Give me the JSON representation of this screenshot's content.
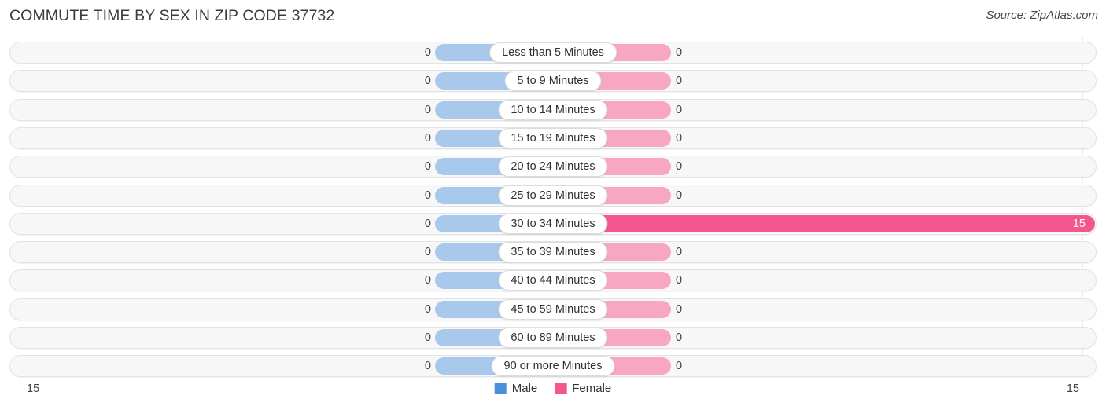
{
  "header": {
    "title": "COMMUTE TIME BY SEX IN ZIP CODE 37732",
    "source": "Source: ZipAtlas.com"
  },
  "legend": {
    "male_label": "Male",
    "female_label": "Female",
    "male_color": "#4a90d9",
    "female_color": "#f4568f"
  },
  "axis": {
    "left": "15",
    "right": "15"
  },
  "chart_data": {
    "type": "bar",
    "title": "COMMUTE TIME BY SEX IN ZIP CODE 37732",
    "orientation": "horizontal-diverging",
    "xlabel": "",
    "ylabel": "",
    "xlim": [
      15,
      15
    ],
    "grid": true,
    "legend_position": "bottom-center",
    "categories": [
      "Less than 5 Minutes",
      "5 to 9 Minutes",
      "10 to 14 Minutes",
      "15 to 19 Minutes",
      "20 to 24 Minutes",
      "25 to 29 Minutes",
      "30 to 34 Minutes",
      "35 to 39 Minutes",
      "40 to 44 Minutes",
      "45 to 59 Minutes",
      "60 to 89 Minutes",
      "90 or more Minutes"
    ],
    "series": [
      {
        "name": "Male",
        "values": [
          0,
          0,
          0,
          0,
          0,
          0,
          0,
          0,
          0,
          0,
          0,
          0
        ],
        "labels": [
          "0",
          "0",
          "0",
          "0",
          "0",
          "0",
          "0",
          "0",
          "0",
          "0",
          "0",
          "0"
        ]
      },
      {
        "name": "Female",
        "values": [
          0,
          0,
          0,
          0,
          0,
          0,
          15,
          0,
          0,
          0,
          0,
          0
        ],
        "labels": [
          "0",
          "0",
          "0",
          "0",
          "0",
          "0",
          "15",
          "0",
          "0",
          "0",
          "0",
          "0"
        ]
      }
    ]
  }
}
